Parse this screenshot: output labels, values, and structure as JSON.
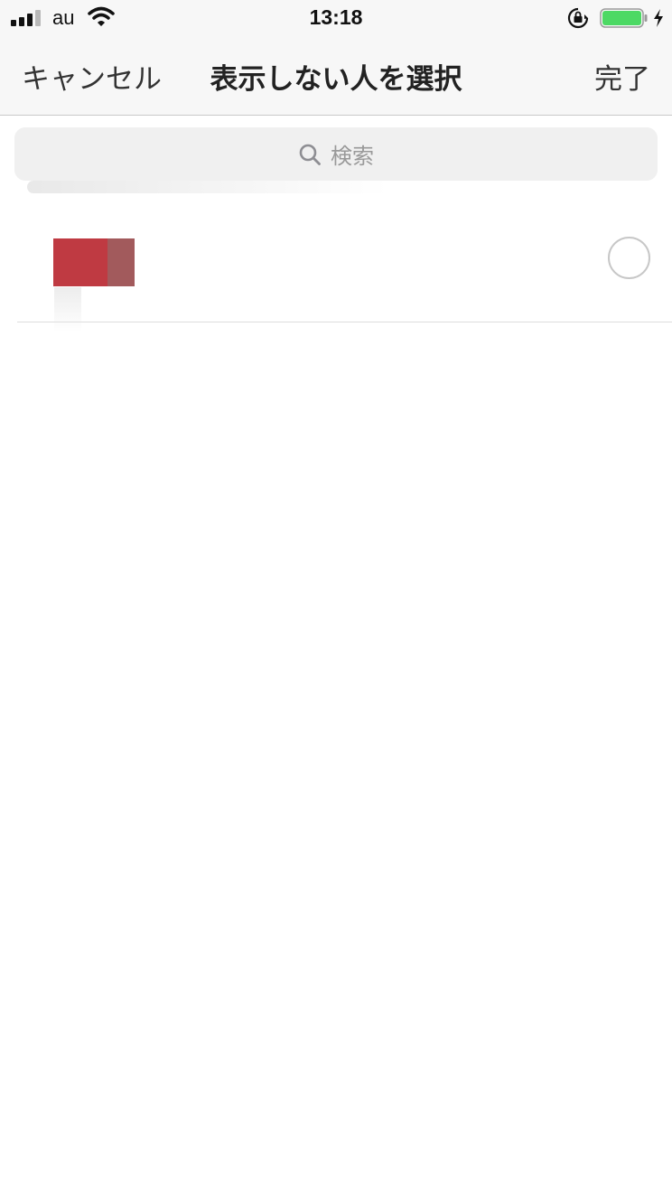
{
  "status_bar": {
    "carrier": "au",
    "time": "13:18",
    "icons": [
      "signal-icon",
      "wifi-icon",
      "rotation-lock-icon",
      "battery-icon",
      "charging-icon"
    ],
    "battery_level": 1.0,
    "battery_color": "#4cd964"
  },
  "nav": {
    "cancel_label": "キャンセル",
    "title": "表示しない人を選択",
    "done_label": "完了"
  },
  "search": {
    "placeholder": "検索",
    "icon": "search-icon"
  },
  "friends": [
    {
      "name": "",
      "avatar_colors": [
        "#bf3a42",
        "#a25a5c"
      ],
      "selected": false
    }
  ]
}
